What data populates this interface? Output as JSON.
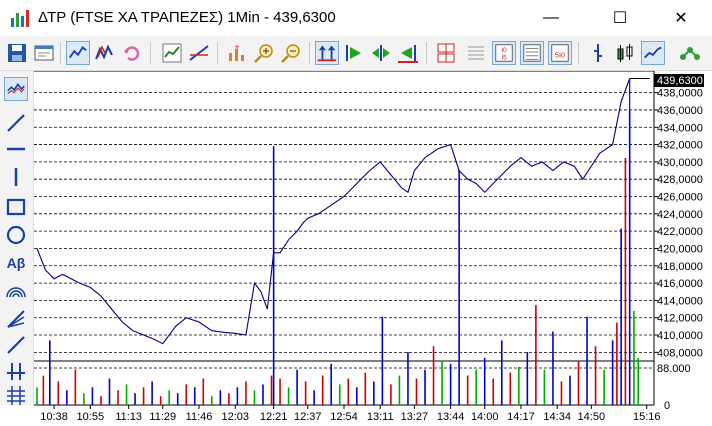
{
  "window": {
    "title": "ΔΤΡ (FTSE ΧΑ ΤΡΑΠΕΖΕΣ) 1Min - 439,6300",
    "minimize": "—",
    "maximize": "☐",
    "close": "✕"
  },
  "colors": {
    "price_line": "#000080",
    "volume_blue": "#0000cc",
    "volume_red": "#cc0000",
    "volume_green": "#00aa00",
    "grid": "#000000",
    "last_price_bg": "#000000"
  },
  "toolbar": [
    "save-icon",
    "properties-icon",
    "line-chart-icon",
    "compare-chart-icon",
    "refresh-icon",
    "indicator-icon",
    "trendline-icon",
    "add-study-icon",
    "zoom-in-icon",
    "zoom-out-icon",
    "auto-scale-icon",
    "scroll-right-icon",
    "fit-chart-icon",
    "scroll-left-icon",
    "split-view-icon",
    "grid-icon",
    "grid-dots-icon",
    "ruler-icon",
    "bar-chart-icon",
    "candlestick-icon",
    "line-style-icon",
    "pattern-icon"
  ],
  "left_tools": [
    "line-tool-icon",
    "diagonal-line-icon",
    "horizontal-line-icon",
    "vertical-line-icon",
    "rectangle-tool-icon",
    "ellipse-tool-icon",
    "text-tool-icon",
    "arc-tool-icon",
    "fibonacci-tool-icon",
    "ray-tool-icon",
    "cross-tool-icon",
    "multiline-tool-icon"
  ],
  "left_text_tool": "Aβ",
  "chart_data": {
    "type": "line",
    "last_price_label": "439,6300",
    "y_ticks": [
      "438,0000",
      "436,0000",
      "434,0000",
      "432,0000",
      "430,0000",
      "428,0000",
      "426,0000",
      "424,0000",
      "422,0000",
      "420,0000",
      "418,0000",
      "416,0000",
      "414,0000",
      "412,0000",
      "410,0000",
      "408,0000"
    ],
    "ylim": [
      407,
      440.5
    ],
    "volume_ticks": [
      "88.000",
      "0"
    ],
    "volume_max": 88000,
    "x_ticks": [
      "10:38",
      "10:55",
      "11:13",
      "11:29",
      "11:46",
      "12:03",
      "12:21",
      "12:37",
      "12:54",
      "13:11",
      "13:27",
      "13:44",
      "14:00",
      "14:17",
      "14:34",
      "14:50",
      "15:16"
    ],
    "series": [
      {
        "x": [
          "10:30",
          "10:34",
          "10:38",
          "10:42",
          "10:46",
          "10:50",
          "10:55",
          "11:00",
          "11:05",
          "11:10",
          "11:15",
          "11:20",
          "11:25",
          "11:29",
          "11:35",
          "11:40",
          "11:46",
          "11:52",
          "11:58",
          "12:03",
          "12:08",
          "12:12",
          "12:15",
          "12:18",
          "12:21",
          "12:24",
          "12:28",
          "12:32",
          "12:35",
          "12:37",
          "12:42",
          "12:48",
          "12:54",
          "13:00",
          "13:06",
          "13:11",
          "13:16",
          "13:21",
          "13:24",
          "13:27",
          "13:32",
          "13:38",
          "13:44",
          "13:48",
          "13:52",
          "13:56",
          "14:00",
          "14:04",
          "14:08",
          "14:12",
          "14:17",
          "14:22",
          "14:27",
          "14:32",
          "14:37",
          "14:42",
          "14:46",
          "14:50",
          "14:54",
          "15:00",
          "15:04",
          "15:08"
        ],
        "values": [
          420.0,
          417.5,
          416.5,
          417.0,
          416.5,
          416.0,
          415.5,
          414.5,
          413.0,
          411.5,
          410.5,
          410.0,
          409.5,
          409.0,
          411.0,
          412.0,
          411.5,
          410.5,
          410.3,
          410.2,
          410.0,
          416.0,
          415.0,
          413.0,
          419.5,
          419.5,
          421.0,
          422.0,
          423.0,
          423.5,
          424.0,
          425.0,
          426.0,
          427.5,
          429.0,
          430.0,
          428.5,
          427.0,
          426.5,
          429.0,
          430.5,
          431.5,
          432.0,
          429.0,
          428.0,
          427.5,
          426.5,
          427.5,
          428.5,
          429.5,
          430.5,
          429.5,
          430.0,
          429.0,
          430.0,
          429.5,
          428.0,
          429.5,
          431.0,
          432.0,
          437.0,
          439.63
        ]
      }
    ],
    "volume": {
      "x": [
        "10:30",
        "10:33",
        "10:36",
        "10:40",
        "10:44",
        "10:48",
        "10:52",
        "10:56",
        "11:00",
        "11:04",
        "11:08",
        "11:12",
        "11:16",
        "11:20",
        "11:24",
        "11:28",
        "11:32",
        "11:36",
        "11:40",
        "11:44",
        "11:48",
        "11:52",
        "11:56",
        "12:00",
        "12:04",
        "12:08",
        "12:12",
        "12:16",
        "12:20",
        "12:21",
        "12:24",
        "12:28",
        "12:32",
        "12:36",
        "12:40",
        "12:44",
        "12:48",
        "12:52",
        "12:56",
        "13:00",
        "13:04",
        "13:08",
        "13:12",
        "13:16",
        "13:20",
        "13:24",
        "13:28",
        "13:32",
        "13:36",
        "13:40",
        "13:44",
        "13:48",
        "13:52",
        "13:56",
        "14:00",
        "14:04",
        "14:08",
        "14:12",
        "14:16",
        "14:20",
        "14:24",
        "14:28",
        "14:32",
        "14:36",
        "14:40",
        "14:44",
        "14:48",
        "14:52",
        "14:56",
        "15:00",
        "15:02",
        "15:04",
        "15:06",
        "15:08",
        "15:10",
        "15:12"
      ],
      "values": [
        6,
        10,
        22,
        8,
        5,
        12,
        4,
        6,
        3,
        9,
        5,
        7,
        4,
        6,
        8,
        3,
        5,
        4,
        7,
        6,
        9,
        3,
        5,
        4,
        6,
        8,
        5,
        7,
        10,
        88,
        9,
        6,
        12,
        8,
        5,
        10,
        14,
        7,
        9,
        6,
        11,
        8,
        30,
        7,
        10,
        18,
        9,
        12,
        20,
        15,
        14,
        80,
        10,
        12,
        16,
        9,
        22,
        11,
        13,
        18,
        34,
        12,
        25,
        8,
        10,
        15,
        30,
        20,
        12,
        22,
        28,
        60,
        84,
        100,
        32,
        16
      ],
      "colors": [
        "g",
        "r",
        "b",
        "r",
        "b",
        "r",
        "g",
        "b",
        "r",
        "b",
        "r",
        "g",
        "b",
        "r",
        "b",
        "r",
        "g",
        "b",
        "r",
        "b",
        "r",
        "g",
        "b",
        "r",
        "b",
        "r",
        "g",
        "b",
        "r",
        "b",
        "r",
        "g",
        "b",
        "r",
        "b",
        "r",
        "b",
        "g",
        "r",
        "b",
        "r",
        "b",
        "b",
        "r",
        "g",
        "b",
        "r",
        "b",
        "r",
        "g",
        "b",
        "b",
        "r",
        "g",
        "b",
        "r",
        "b",
        "r",
        "g",
        "b",
        "r",
        "g",
        "b",
        "r",
        "b",
        "r",
        "b",
        "r",
        "g",
        "b",
        "r",
        "b",
        "r",
        "b",
        "g",
        "g"
      ]
    }
  }
}
